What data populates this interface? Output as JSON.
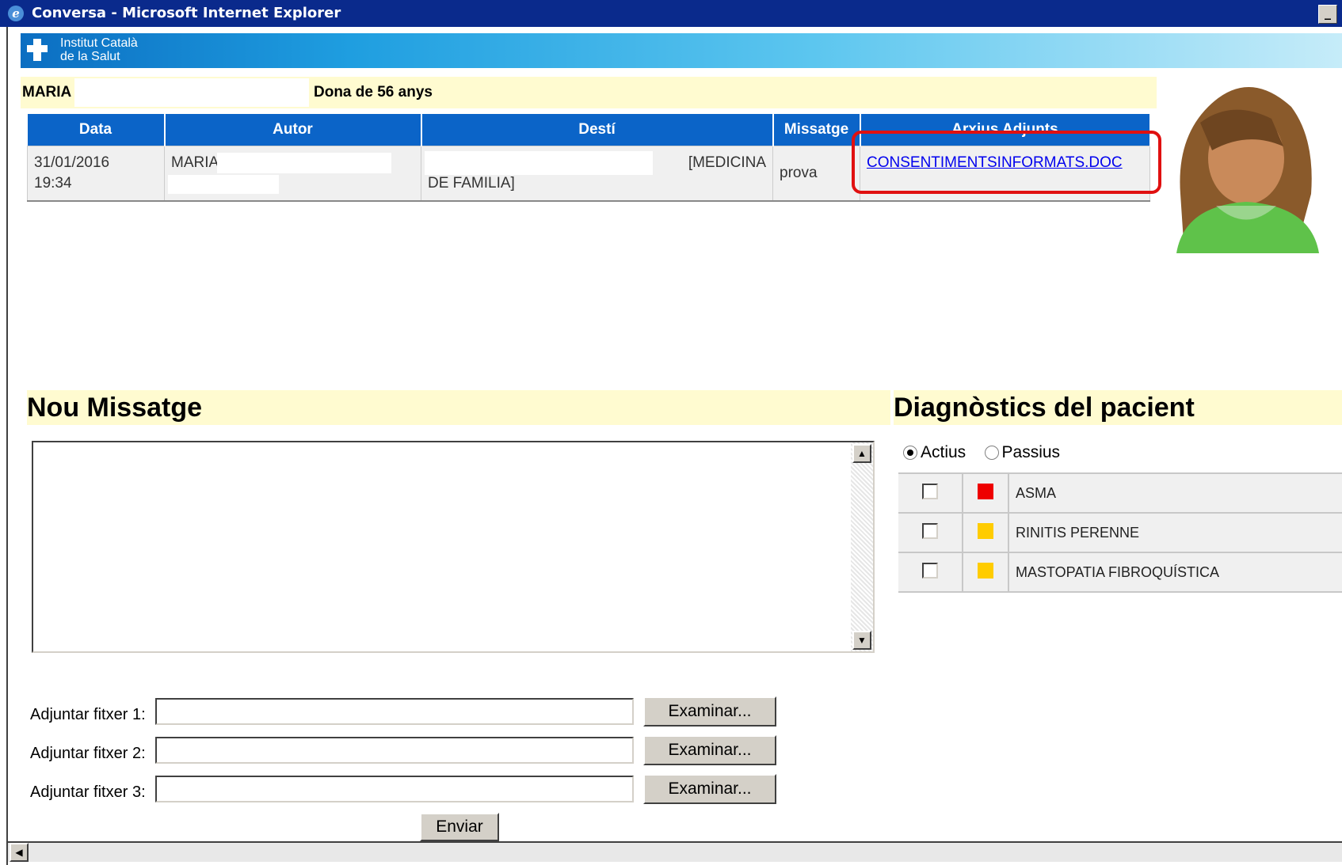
{
  "window": {
    "title": "Conversa - Microsoft Internet Explorer"
  },
  "header": {
    "org_line1": "Institut Català",
    "org_line2": "de la Salut"
  },
  "patient": {
    "name": "MARIA",
    "description": "Dona de 56 anys"
  },
  "messages": {
    "columns": [
      "Data",
      "Autor",
      "Destí",
      "Missatge",
      "Arxius Adjunts"
    ],
    "rows": [
      {
        "date": "31/01/2016",
        "time": "19:34",
        "author": "MARIA",
        "destination_line1": "[MEDICINA",
        "destination_line2": "DE FAMILIA]",
        "message": "prova",
        "attachment": "CONSENTIMENTSINFORMATS.DOC"
      }
    ]
  },
  "new_message": {
    "heading": "Nou Missatge",
    "body": ""
  },
  "diagnostics": {
    "heading": "Diagnòstics del pacient",
    "filter_active": "Actius",
    "filter_passive": "Passius",
    "selected_filter": "Actius",
    "items": [
      {
        "label": "ASMA",
        "color": "#ee0000",
        "checked": false
      },
      {
        "label": "RINITIS PERENNE",
        "color": "#ffcc00",
        "checked": false
      },
      {
        "label": "MASTOPATIA FIBROQUÍSTICA",
        "color": "#ffcc00",
        "checked": false
      }
    ]
  },
  "attachments": {
    "fields": [
      {
        "label": "Adjuntar fitxer 1:",
        "value": "",
        "button": "Examinar..."
      },
      {
        "label": "Adjuntar fitxer 2:",
        "value": "",
        "button": "Examinar..."
      },
      {
        "label": "Adjuntar fitxer 3:",
        "value": "",
        "button": "Examinar..."
      }
    ],
    "send_label": "Enviar"
  },
  "icons": {
    "browser": "ie-icon",
    "logo": "health-cross-icon",
    "avatar": "female-patient-avatar"
  }
}
